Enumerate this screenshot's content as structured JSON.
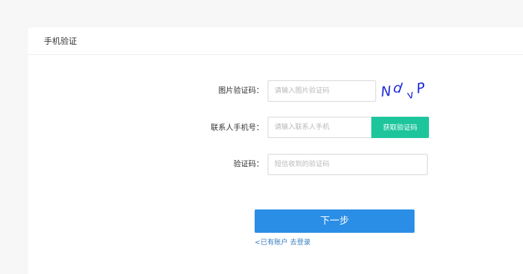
{
  "panel": {
    "title": "手机验证"
  },
  "form": {
    "captcha": {
      "label": "图片验证码：",
      "placeholder": "请输入图片验证码",
      "captcha_image_text": "Nd vP"
    },
    "phone": {
      "label": "联系人手机号：",
      "placeholder": "请输入联系人手机",
      "button_label": "获取验证码"
    },
    "sms_code": {
      "label": "验证码：",
      "placeholder": "短信收到的验证码"
    },
    "next_button": "下一步",
    "login_link": "<已有账户 去登录"
  },
  "colors": {
    "primary": "#2b8ee6",
    "sms_button": "#1dc59c",
    "link": "#3b7fc4",
    "captcha_ink": "#1d2bd8"
  }
}
